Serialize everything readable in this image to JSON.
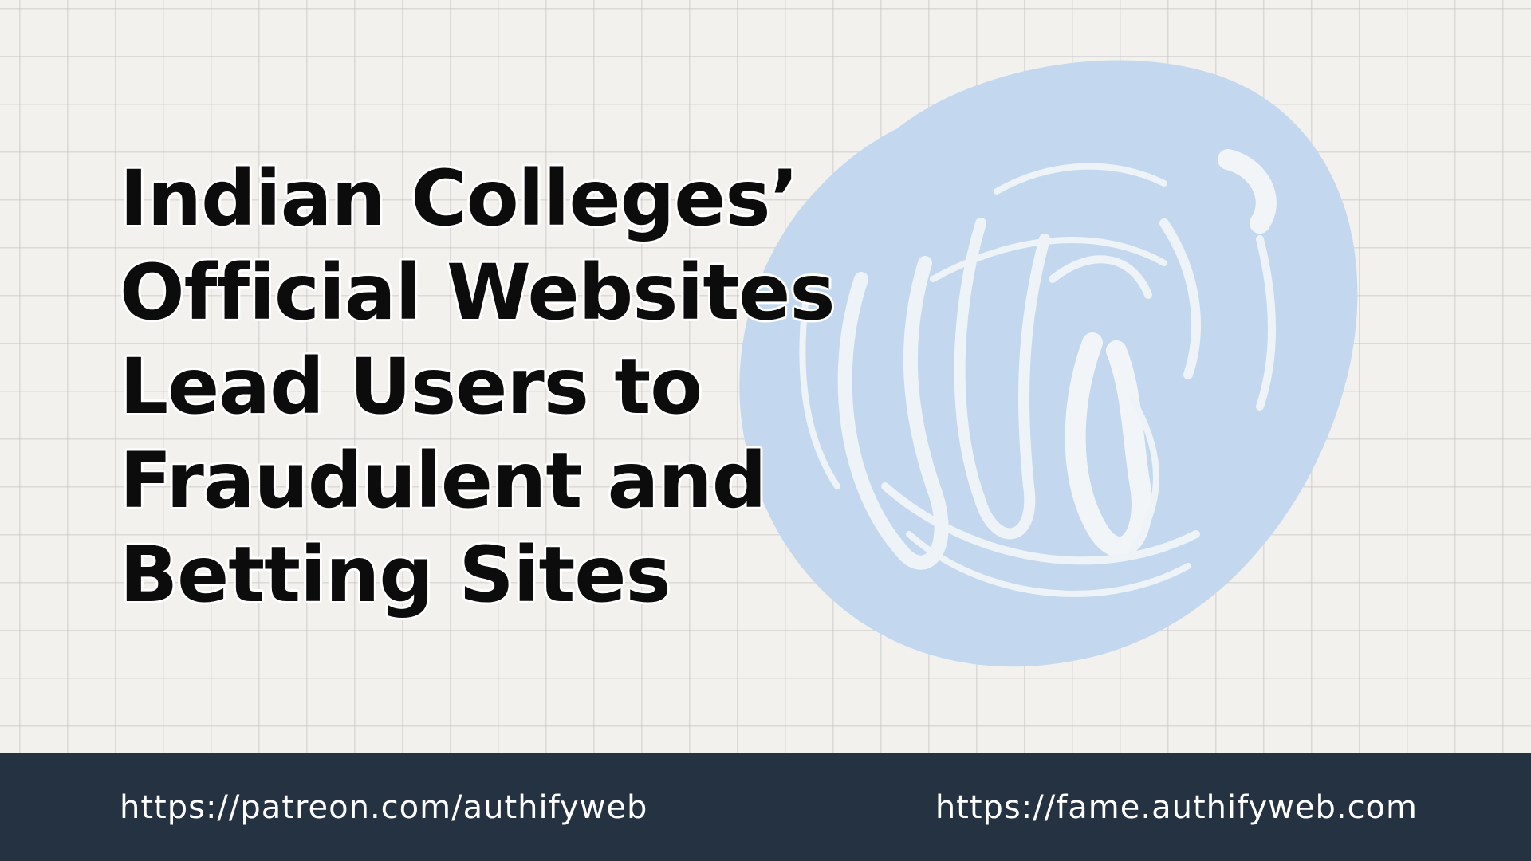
{
  "title": {
    "lines": [
      "Indian Colleges’",
      "Official Websites",
      "Lead Users to",
      "Fraudulent and",
      "Betting Sites"
    ]
  },
  "footer": {
    "left_link": "https://patreon.com/authifyweb",
    "right_link": "https://fame.authifyweb.com"
  },
  "colors": {
    "background": "#f2f1ee",
    "scribble": "#c3d8ee",
    "footer_bg": "#253241",
    "title_text": "#0c0c0c",
    "footer_text": "#ffffff"
  },
  "icons": {
    "scribble": "scribble-doodle-icon"
  }
}
